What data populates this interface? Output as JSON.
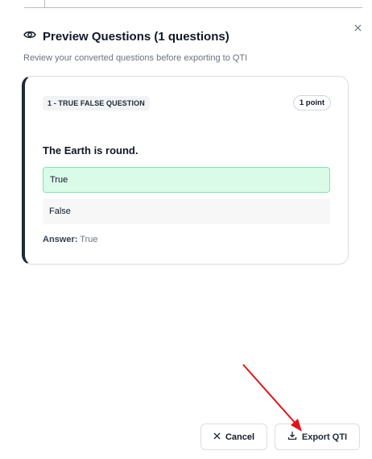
{
  "dialog": {
    "title": "Preview Questions (1 questions)",
    "subtitle": "Review your converted questions before exporting to QTI",
    "icons": {
      "title_icon": "eye-icon",
      "close": "close-icon"
    }
  },
  "question": {
    "label": "1 - TRUE FALSE QUESTION",
    "points": "1 point",
    "text": "The Earth is round.",
    "options": [
      {
        "label": "True",
        "correct": true
      },
      {
        "label": "False",
        "correct": false
      }
    ],
    "answer_label": "Answer:",
    "answer_value": "True"
  },
  "footer": {
    "cancel_label": "Cancel",
    "export_label": "Export QTI",
    "icons": {
      "cancel": "x-icon",
      "export": "download-icon"
    }
  },
  "colors": {
    "correct_bg": "#d9fbe8",
    "correct_border": "#86e2b0",
    "annotation_arrow": "#e0141c"
  }
}
